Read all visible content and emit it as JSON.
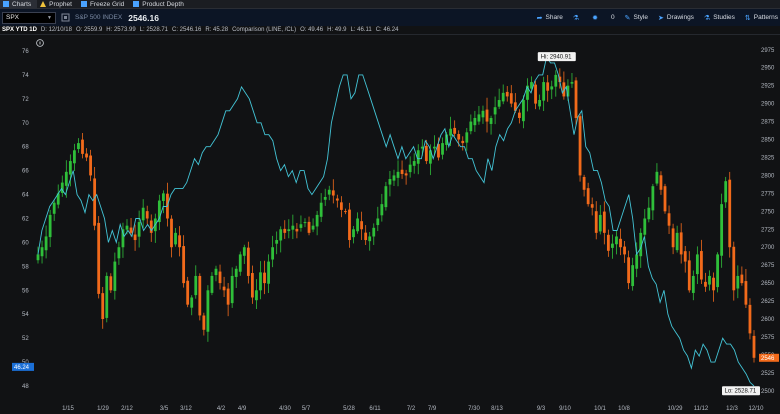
{
  "tabs": [
    {
      "label": "Charts",
      "icon": "bar-chart-icon",
      "active": true
    },
    {
      "label": "Prophet",
      "icon": "warning-triangle-icon",
      "active": false
    },
    {
      "label": "Freeze Grid",
      "icon": "grid-icon",
      "active": false
    },
    {
      "label": "Product Depth",
      "icon": "depth-icon",
      "active": false
    }
  ],
  "toolbar": {
    "symbol": "SPX",
    "description": "S&P 500 INDEX",
    "price": "2546.16",
    "share_label": "Share",
    "alerts_count": "0",
    "style_label": "Style",
    "drawings_label": "Drawings",
    "studies_label": "Studies",
    "patterns_label": "Patterns"
  },
  "infobar": {
    "title": "SPX YTD 1D",
    "date": "D: 12/10/18",
    "open": "O: 2559.9",
    "high": "H: 2573.99",
    "low": "L: 2528.71",
    "close": "C: 2546.16",
    "range": "R: 45.28",
    "comparison": "Comparison (LINE, /CL)",
    "cmp_open": "O: 49.46",
    "cmp_high": "H: 49.9",
    "cmp_low": "L: 46.11",
    "cmp_close": "C: 46.24"
  },
  "colors": {
    "up": "#2fbf3a",
    "down": "#f26a1b",
    "comparison": "#43c4d6",
    "background": "#111214",
    "left_price_tag": "#1b6fd6",
    "right_price_tag": "#f26a1b"
  },
  "chart_data": {
    "type": "candlestick",
    "title": "SPX YTD 1D",
    "left_axis": {
      "ticks": [
        "76",
        "74",
        "72",
        "70",
        "68",
        "66",
        "64",
        "62",
        "60",
        "58",
        "56",
        "54",
        "52",
        "50",
        "48"
      ],
      "range": [
        47,
        77
      ]
    },
    "right_axis": {
      "ticks": [
        "2975",
        "2950",
        "2925",
        "2900",
        "2875",
        "2850",
        "2825",
        "2800",
        "2775",
        "2750",
        "2725",
        "2700",
        "2675",
        "2650",
        "2625",
        "2600",
        "2575",
        "2550",
        "2525",
        "2500"
      ],
      "range": [
        2490,
        2990
      ]
    },
    "x_ticks": [
      "1/15",
      "1/29",
      "2/12",
      "3/5",
      "3/12",
      "4/2",
      "4/9",
      "4/30",
      "5/7",
      "5/28",
      "6/11",
      "7/2",
      "7/9",
      "7/30",
      "8/13",
      "9/3",
      "9/10",
      "10/1",
      "10/8",
      "10/29",
      "11/12",
      "12/3",
      "12/10"
    ],
    "current_left_label": "46.24",
    "current_right_label": "2546",
    "high_label": "Hi: 2940.91",
    "low_label": "Lo: 2528.71",
    "spx_close": [
      2690,
      2700,
      2715,
      2745,
      2762,
      2775,
      2790,
      2805,
      2820,
      2835,
      2845,
      2830,
      2825,
      2800,
      2730,
      2635,
      2600,
      2660,
      2640,
      2680,
      2700,
      2725,
      2730,
      2720,
      2710,
      2735,
      2755,
      2740,
      2720,
      2740,
      2765,
      2775,
      2740,
      2700,
      2720,
      2700,
      2650,
      2620,
      2630,
      2660,
      2605,
      2585,
      2640,
      2660,
      2670,
      2650,
      2640,
      2620,
      2660,
      2670,
      2690,
      2700,
      2660,
      2630,
      2640,
      2665,
      2650,
      2680,
      2700,
      2710,
      2725,
      2720,
      2725,
      2730,
      2722,
      2732,
      2735,
      2720,
      2730,
      2745,
      2762,
      2770,
      2780,
      2772,
      2765,
      2752,
      2750,
      2710,
      2725,
      2740,
      2725,
      2710,
      2715,
      2727,
      2740,
      2760,
      2785,
      2795,
      2800,
      2805,
      2802,
      2800,
      2815,
      2820,
      2835,
      2840,
      2820,
      2835,
      2840,
      2825,
      2845,
      2857,
      2865,
      2858,
      2850,
      2845,
      2860,
      2875,
      2880,
      2885,
      2890,
      2875,
      2880,
      2895,
      2905,
      2915,
      2910,
      2900,
      2890,
      2880,
      2905,
      2925,
      2930,
      2900,
      2905,
      2930,
      2918,
      2924,
      2940,
      2930,
      2910,
      2925,
      2930,
      2880,
      2800,
      2780,
      2760,
      2755,
      2720,
      2745,
      2720,
      2695,
      2705,
      2715,
      2700,
      2690,
      2650,
      2675,
      2690,
      2720,
      2740,
      2755,
      2785,
      2805,
      2780,
      2750,
      2730,
      2700,
      2720,
      2690,
      2680,
      2640,
      2660,
      2690,
      2655,
      2645,
      2660,
      2640,
      2690,
      2760,
      2792,
      2700,
      2640,
      2660,
      2650,
      2620,
      2580,
      2546
    ]
  }
}
